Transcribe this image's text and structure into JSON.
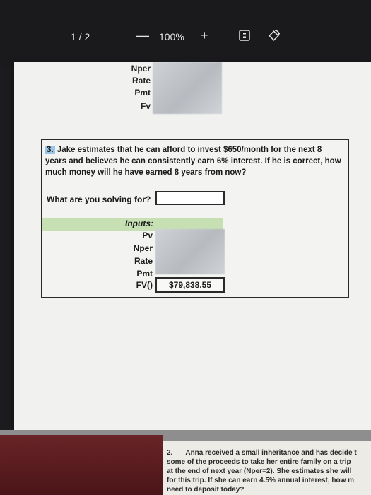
{
  "toolbar": {
    "page_count": "1 / 2",
    "zoom_out": "—",
    "zoom_level": "100%",
    "zoom_in": "+"
  },
  "icons": {
    "fit": "fit-page-icon",
    "rotate": "rotate-icon"
  },
  "top_table": {
    "labels": [
      "Nper",
      "Rate",
      "Pmt",
      "Fv"
    ]
  },
  "question3": {
    "number": "3.",
    "text": "Jake estimates that he can afford to invest $650/month for the next 8 years and believes he can consistently earn 6% interest. If he is correct, how much money will he have earned 8 years from now?",
    "solving_label": "What are you solving for?",
    "inputs_label": "Inputs:",
    "input_labels": [
      "Pv",
      "Nper",
      "Rate",
      "Pmt",
      "FV()"
    ],
    "fv_value": "$79,838.55"
  },
  "question2": {
    "number": "2.",
    "line1": "Anna received a small inheritance and has decide t",
    "line2": "some of the proceeds to take her entire family on a trip",
    "line3": "at the end of next year (Nper=2). She estimates she will",
    "line4": "for this trip. If she can earn 4.5% annual interest, how m",
    "line5": "need to deposit today?"
  },
  "colors": {
    "inputs_band": "#c6e0b4",
    "question_number_highlight": "#9cc6e8",
    "bottom_left": "#5a1c20"
  }
}
